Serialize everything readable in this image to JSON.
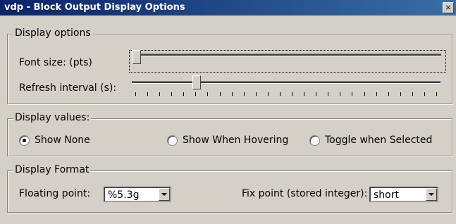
{
  "window": {
    "title": "vdp - Block Output Display Options",
    "close_glyph": "×"
  },
  "display_options": {
    "legend": "Display options",
    "font_size": {
      "label": "Font size: (pts)",
      "slider_value": 0.0
    },
    "refresh_interval": {
      "label": "Refresh interval (s):",
      "slider_value": 0.2,
      "tick_count": 26
    }
  },
  "display_values": {
    "legend": "Display values:",
    "options": [
      {
        "label": "Show None",
        "selected": true
      },
      {
        "label": "Show When Hovering",
        "selected": false
      },
      {
        "label": "Toggle when Selected",
        "selected": false
      }
    ]
  },
  "display_format": {
    "legend": "Display Format",
    "floating_point": {
      "label": "Floating point:",
      "value": "%5.3g"
    },
    "fix_point": {
      "label": "Fix point (stored integer):",
      "value": "short"
    }
  }
}
